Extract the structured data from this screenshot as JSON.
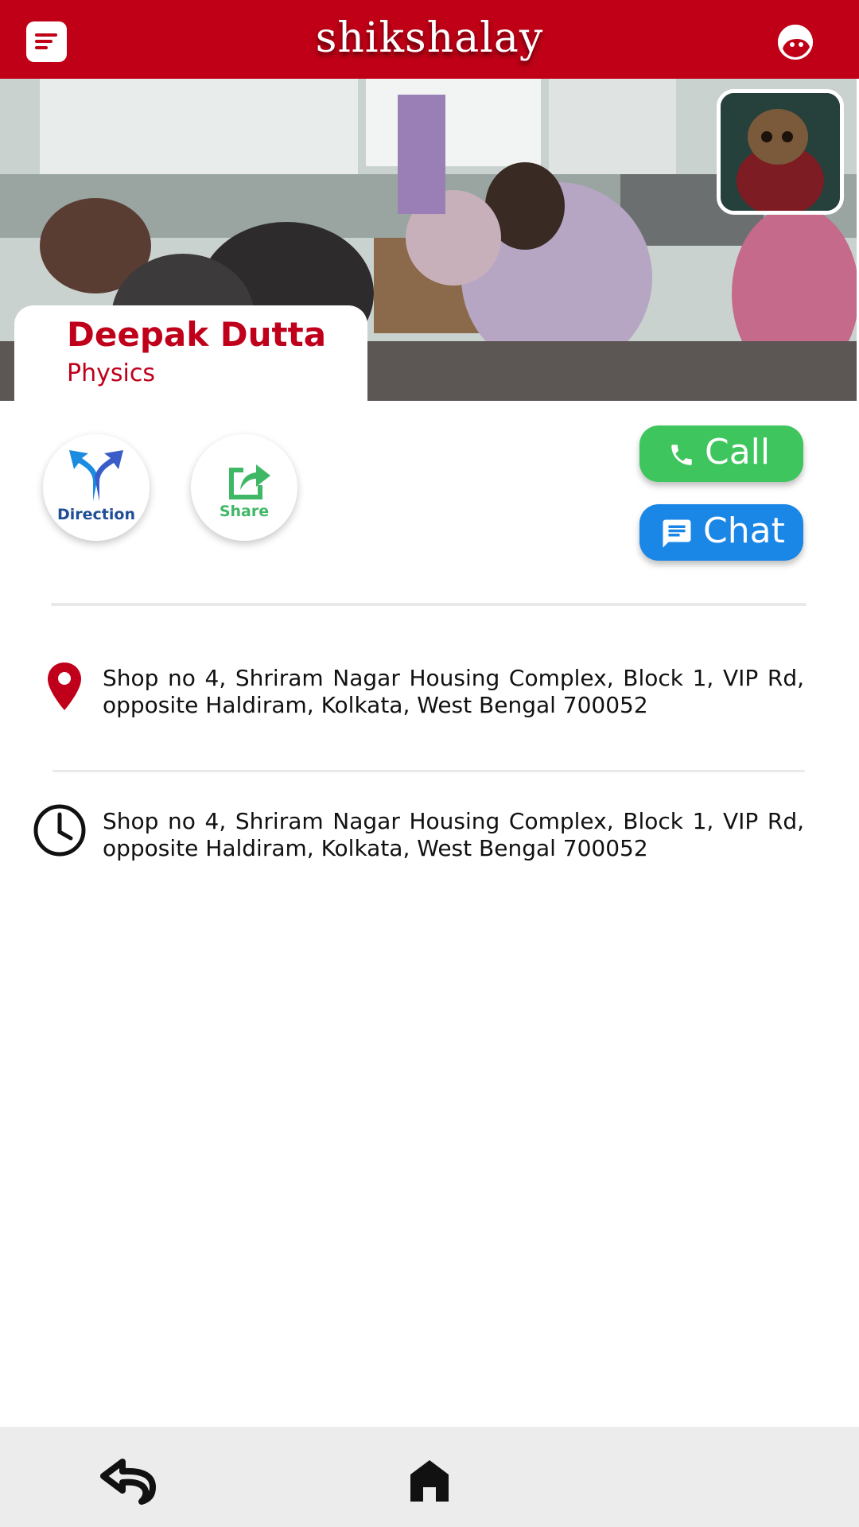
{
  "header": {
    "brand": "shikshalay",
    "menu_icon": "menu-icon",
    "profile_icon": "profile-icon",
    "color": "#bf0016"
  },
  "teacher": {
    "name": "Deepak Dutta",
    "subject": "Physics"
  },
  "actions": {
    "direction_label": "Direction",
    "share_label": "Share",
    "call_label": "Call",
    "chat_label": "Chat",
    "call_color": "#3fc55d",
    "chat_color": "#1a86e6"
  },
  "details": {
    "address": "Shop no 4, Shriram Nagar Housing Complex, Block 1, VIP Rd, opposite Haldiram, Kolkata, West Bengal 700052",
    "timing": "Shop no 4, Shriram Nagar Housing Complex, Block 1, VIP Rd, opposite Haldiram, Kolkata, West Bengal 700052"
  },
  "bottom_nav": {
    "back_icon": "back-icon",
    "home_icon": "home-icon"
  }
}
